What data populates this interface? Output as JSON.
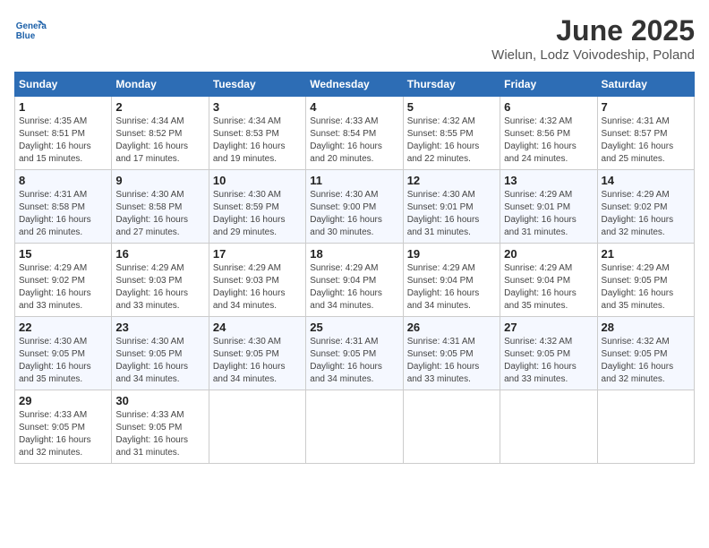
{
  "header": {
    "logo_line1": "General",
    "logo_line2": "Blue",
    "title": "June 2025",
    "subtitle": "Wielun, Lodz Voivodeship, Poland"
  },
  "weekdays": [
    "Sunday",
    "Monday",
    "Tuesday",
    "Wednesday",
    "Thursday",
    "Friday",
    "Saturday"
  ],
  "weeks": [
    [
      {
        "day": "1",
        "sunrise": "4:35 AM",
        "sunset": "8:51 PM",
        "daylight": "16 hours and 15 minutes."
      },
      {
        "day": "2",
        "sunrise": "4:34 AM",
        "sunset": "8:52 PM",
        "daylight": "16 hours and 17 minutes."
      },
      {
        "day": "3",
        "sunrise": "4:34 AM",
        "sunset": "8:53 PM",
        "daylight": "16 hours and 19 minutes."
      },
      {
        "day": "4",
        "sunrise": "4:33 AM",
        "sunset": "8:54 PM",
        "daylight": "16 hours and 20 minutes."
      },
      {
        "day": "5",
        "sunrise": "4:32 AM",
        "sunset": "8:55 PM",
        "daylight": "16 hours and 22 minutes."
      },
      {
        "day": "6",
        "sunrise": "4:32 AM",
        "sunset": "8:56 PM",
        "daylight": "16 hours and 24 minutes."
      },
      {
        "day": "7",
        "sunrise": "4:31 AM",
        "sunset": "8:57 PM",
        "daylight": "16 hours and 25 minutes."
      }
    ],
    [
      {
        "day": "8",
        "sunrise": "4:31 AM",
        "sunset": "8:58 PM",
        "daylight": "16 hours and 26 minutes."
      },
      {
        "day": "9",
        "sunrise": "4:30 AM",
        "sunset": "8:58 PM",
        "daylight": "16 hours and 27 minutes."
      },
      {
        "day": "10",
        "sunrise": "4:30 AM",
        "sunset": "8:59 PM",
        "daylight": "16 hours and 29 minutes."
      },
      {
        "day": "11",
        "sunrise": "4:30 AM",
        "sunset": "9:00 PM",
        "daylight": "16 hours and 30 minutes."
      },
      {
        "day": "12",
        "sunrise": "4:30 AM",
        "sunset": "9:01 PM",
        "daylight": "16 hours and 31 minutes."
      },
      {
        "day": "13",
        "sunrise": "4:29 AM",
        "sunset": "9:01 PM",
        "daylight": "16 hours and 31 minutes."
      },
      {
        "day": "14",
        "sunrise": "4:29 AM",
        "sunset": "9:02 PM",
        "daylight": "16 hours and 32 minutes."
      }
    ],
    [
      {
        "day": "15",
        "sunrise": "4:29 AM",
        "sunset": "9:02 PM",
        "daylight": "16 hours and 33 minutes."
      },
      {
        "day": "16",
        "sunrise": "4:29 AM",
        "sunset": "9:03 PM",
        "daylight": "16 hours and 33 minutes."
      },
      {
        "day": "17",
        "sunrise": "4:29 AM",
        "sunset": "9:03 PM",
        "daylight": "16 hours and 34 minutes."
      },
      {
        "day": "18",
        "sunrise": "4:29 AM",
        "sunset": "9:04 PM",
        "daylight": "16 hours and 34 minutes."
      },
      {
        "day": "19",
        "sunrise": "4:29 AM",
        "sunset": "9:04 PM",
        "daylight": "16 hours and 34 minutes."
      },
      {
        "day": "20",
        "sunrise": "4:29 AM",
        "sunset": "9:04 PM",
        "daylight": "16 hours and 35 minutes."
      },
      {
        "day": "21",
        "sunrise": "4:29 AM",
        "sunset": "9:05 PM",
        "daylight": "16 hours and 35 minutes."
      }
    ],
    [
      {
        "day": "22",
        "sunrise": "4:30 AM",
        "sunset": "9:05 PM",
        "daylight": "16 hours and 35 minutes."
      },
      {
        "day": "23",
        "sunrise": "4:30 AM",
        "sunset": "9:05 PM",
        "daylight": "16 hours and 34 minutes."
      },
      {
        "day": "24",
        "sunrise": "4:30 AM",
        "sunset": "9:05 PM",
        "daylight": "16 hours and 34 minutes."
      },
      {
        "day": "25",
        "sunrise": "4:31 AM",
        "sunset": "9:05 PM",
        "daylight": "16 hours and 34 minutes."
      },
      {
        "day": "26",
        "sunrise": "4:31 AM",
        "sunset": "9:05 PM",
        "daylight": "16 hours and 33 minutes."
      },
      {
        "day": "27",
        "sunrise": "4:32 AM",
        "sunset": "9:05 PM",
        "daylight": "16 hours and 33 minutes."
      },
      {
        "day": "28",
        "sunrise": "4:32 AM",
        "sunset": "9:05 PM",
        "daylight": "16 hours and 32 minutes."
      }
    ],
    [
      {
        "day": "29",
        "sunrise": "4:33 AM",
        "sunset": "9:05 PM",
        "daylight": "16 hours and 32 minutes."
      },
      {
        "day": "30",
        "sunrise": "4:33 AM",
        "sunset": "9:05 PM",
        "daylight": "16 hours and 31 minutes."
      },
      null,
      null,
      null,
      null,
      null
    ]
  ]
}
